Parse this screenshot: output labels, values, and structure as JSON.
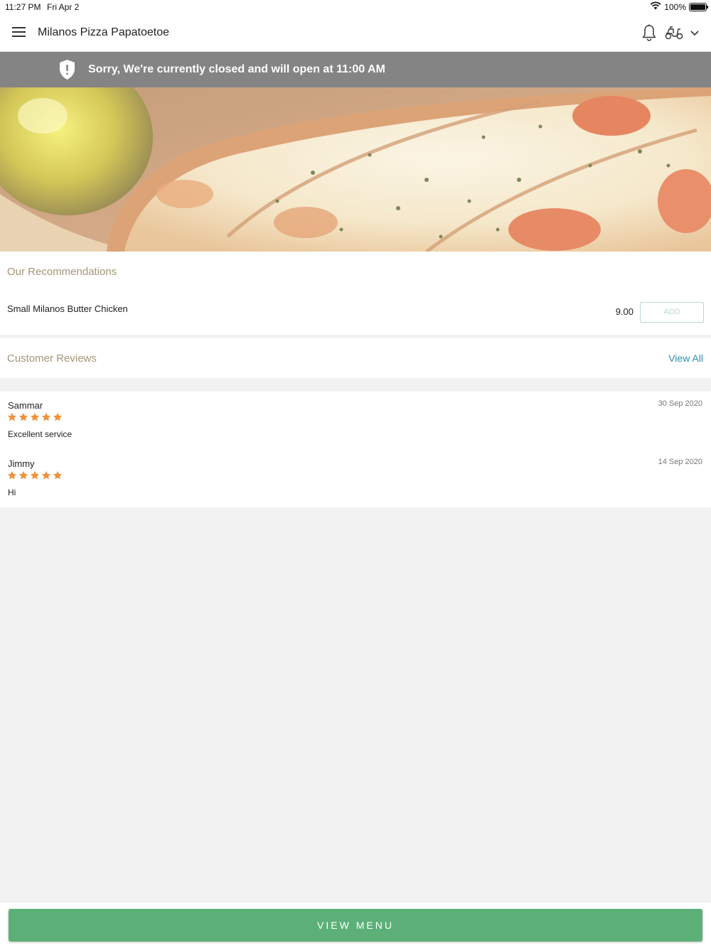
{
  "status_bar": {
    "time": "11:27 PM",
    "date": "Fri Apr 2",
    "battery": "100%",
    "battery_level": 1.0
  },
  "header": {
    "title": "Milanos Pizza Papatoetoe",
    "icons": [
      "menu-icon",
      "bell-icon",
      "scooter-icon",
      "chevron-down-icon"
    ]
  },
  "banner": {
    "text": "Sorry, We're currently closed and will open at 11:00 AM",
    "icon": "shield-alert-icon",
    "color": "#848484"
  },
  "recommendations": {
    "title": "Our Recommendations",
    "items": [
      {
        "name": "Small Milanos Butter Chicken",
        "price": "9.00",
        "button": "ADD"
      }
    ]
  },
  "reviews": {
    "title": "Customer Reviews",
    "view_all": "View All",
    "items": [
      {
        "author": "Sammar",
        "date": "30 Sep 2020",
        "rating": 5,
        "text": "Excellent service"
      },
      {
        "author": "Jimmy",
        "date": "14 Sep 2020",
        "rating": 5,
        "text": "Hi"
      }
    ]
  },
  "footer": {
    "view_menu": "VIEW MENU"
  },
  "colors": {
    "accent_green": "#5cb077",
    "section_title": "#a69579",
    "link_blue": "#2e8fb0",
    "star_orange": "#f0923a"
  }
}
